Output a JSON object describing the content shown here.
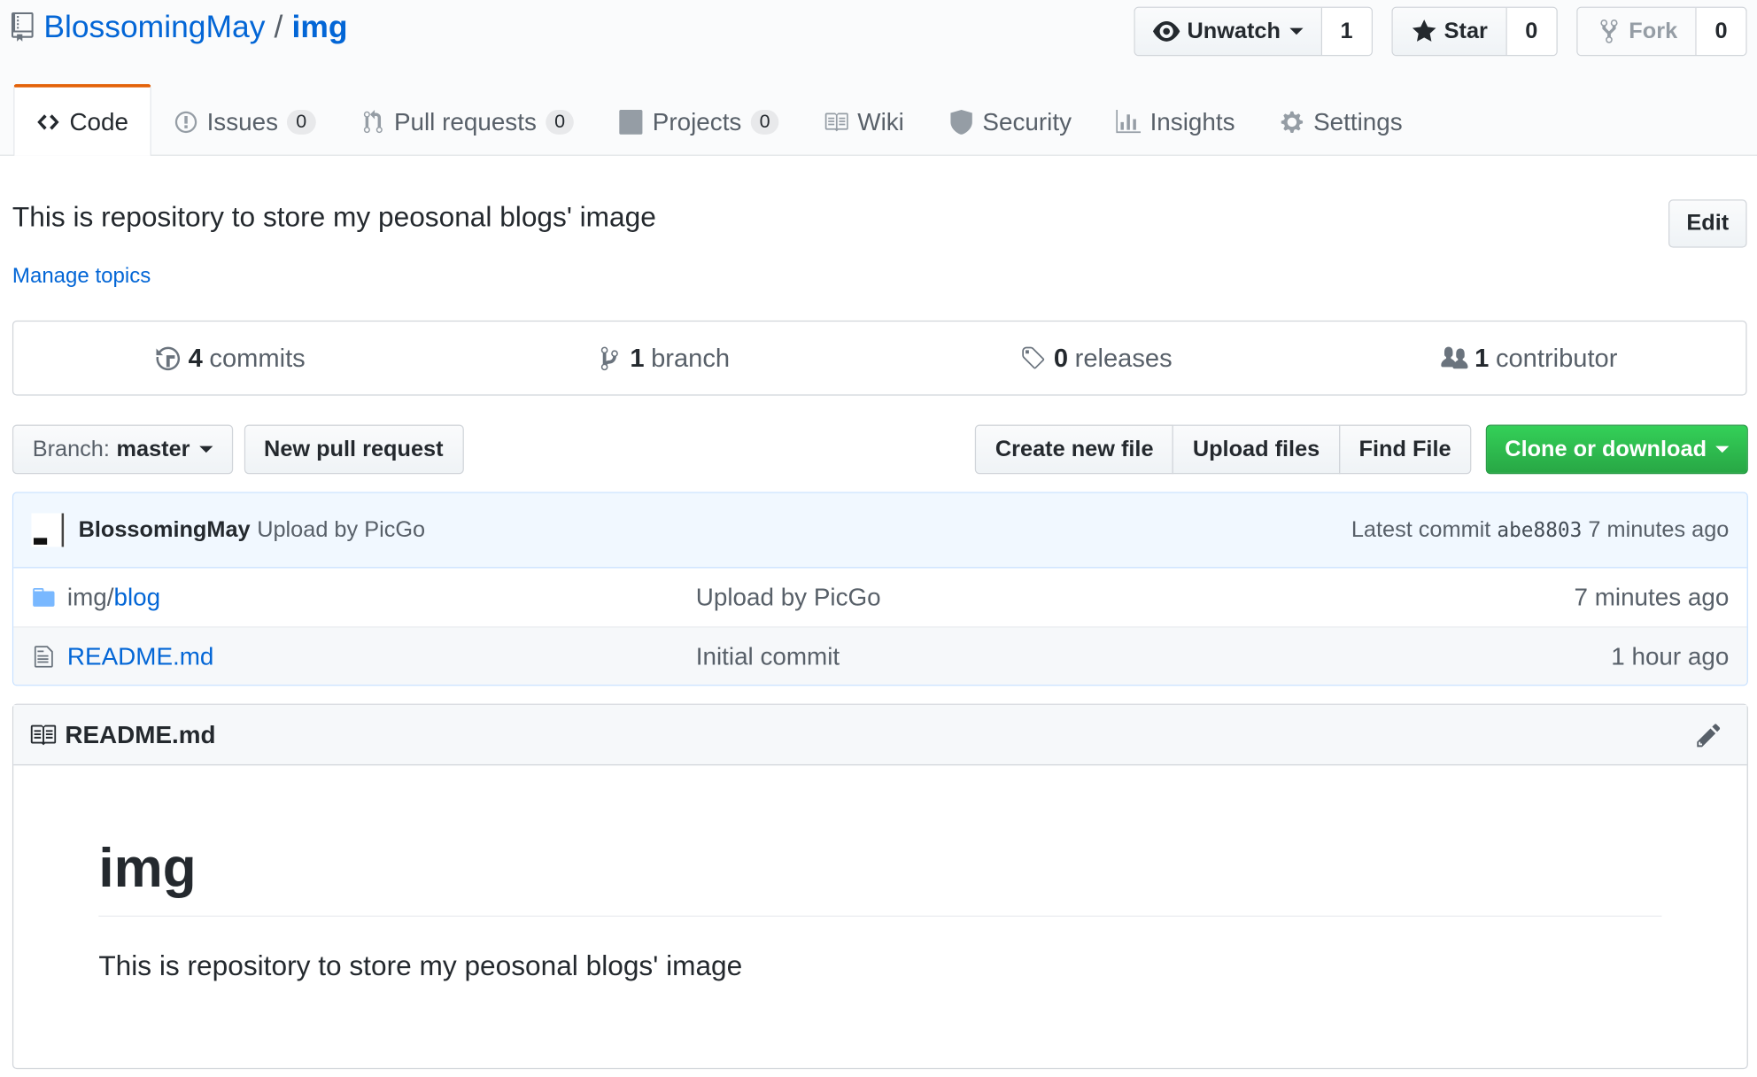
{
  "repo": {
    "owner": "BlossomingMay",
    "separator": "/",
    "name": "img"
  },
  "actions": {
    "watch_label": "Unwatch",
    "watch_count": "1",
    "star_label": "Star",
    "star_count": "0",
    "fork_label": "Fork",
    "fork_count": "0"
  },
  "tabs": [
    {
      "label": "Code",
      "icon": "code-icon"
    },
    {
      "label": "Issues",
      "count": "0",
      "icon": "issue-icon"
    },
    {
      "label": "Pull requests",
      "count": "0",
      "icon": "pull-request-icon"
    },
    {
      "label": "Projects",
      "count": "0",
      "icon": "project-icon"
    },
    {
      "label": "Wiki",
      "icon": "book-icon"
    },
    {
      "label": "Security",
      "icon": "shield-icon"
    },
    {
      "label": "Insights",
      "icon": "graph-icon"
    },
    {
      "label": "Settings",
      "icon": "gear-icon"
    }
  ],
  "description": "This is repository to store my peosonal blogs' image",
  "manage_topics": "Manage topics",
  "edit_label": "Edit",
  "summary": {
    "commits_num": "4",
    "commits_label": "commits",
    "branch_num": "1",
    "branch_label": "branch",
    "releases_num": "0",
    "releases_label": "releases",
    "contributor_num": "1",
    "contributor_label": "contributor"
  },
  "filenav": {
    "branch_prefix": "Branch:",
    "branch_name": "master",
    "new_pr": "New pull request",
    "create_file": "Create new file",
    "upload_files": "Upload files",
    "find_file": "Find File",
    "clone": "Clone or download"
  },
  "latest_commit": {
    "author": "BlossomingMay",
    "message": "Upload by PicGo",
    "prefix": "Latest commit",
    "sha": "abe8803",
    "age": "7 minutes ago"
  },
  "files": [
    {
      "name_prefix": "img/",
      "name": "blog",
      "message": "Upload by PicGo",
      "age": "7 minutes ago",
      "type": "folder"
    },
    {
      "name_prefix": "",
      "name": "README.md",
      "message": "Initial commit",
      "age": "1 hour ago",
      "type": "file"
    }
  ],
  "readme": {
    "filename": "README.md",
    "heading": "img",
    "body": "This is repository to store my peosonal blogs' image"
  },
  "colors": {
    "link": "#0366d6",
    "tab_accent": "#e36209",
    "green": "#28a745"
  }
}
